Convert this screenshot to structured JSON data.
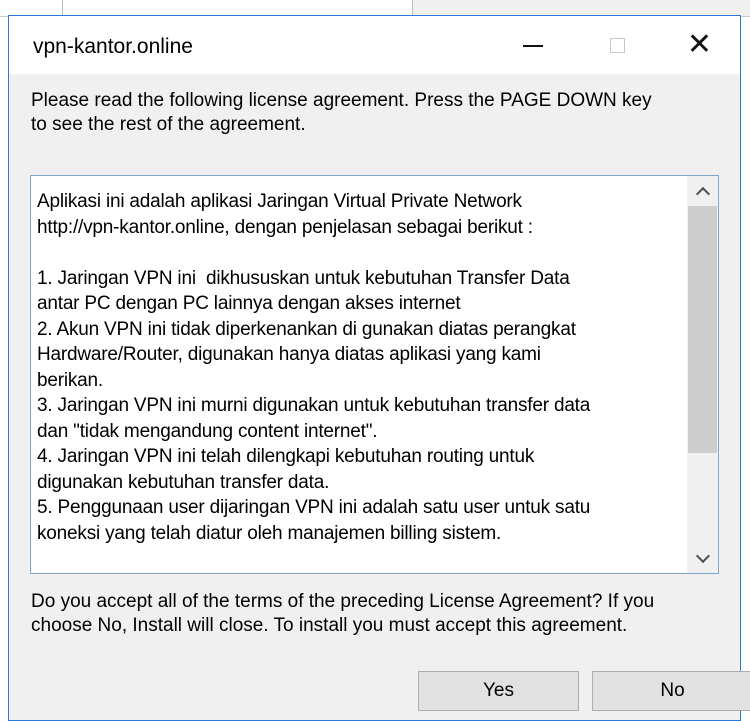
{
  "window": {
    "title": "vpn-kantor.online",
    "controls": {
      "minimize_icon": "minimize-icon",
      "maximize_icon": "maximize-icon",
      "close_icon": "close-icon",
      "close_glyph": "✕"
    }
  },
  "intro": {
    "line1": "Please read the following license agreement. Press the PAGE DOWN key",
    "line2": "to see the rest of the agreement."
  },
  "license": {
    "lines": [
      "Aplikasi ini adalah aplikasi Jaringan Virtual Private Network",
      "http://vpn-kantor.online, dengan penjelasan sebagai berikut :",
      "",
      "1. Jaringan VPN ini  dikhususkan untuk kebutuhan Transfer Data",
      "antar PC dengan PC lainnya dengan akses internet",
      "2. Akun VPN ini tidak diperkenankan di gunakan diatas perangkat",
      "Hardware/Router, digunakan hanya diatas aplikasi yang kami",
      "berikan.",
      "3. Jaringan VPN ini murni digunakan untuk kebutuhan transfer data",
      "dan \"tidak mengandung content internet\".",
      "4. Jaringan VPN ini telah dilengkapi kebutuhan routing untuk",
      "digunakan kebutuhan transfer data.",
      "5. Penggunaan user dijaringan VPN ini adalah satu user untuk satu",
      "koneksi yang telah diatur oleh manajemen billing sistem."
    ],
    "scrollbar": {
      "up_icon": "scroll-up-icon",
      "down_icon": "scroll-down-icon"
    }
  },
  "question": {
    "line1": "Do you accept all of the terms of the preceding License Agreement? If you",
    "line2": "choose No, Install will close. To install you must accept this agreement."
  },
  "buttons": {
    "yes_label": "Yes",
    "no_label": "No"
  },
  "colors": {
    "window_border": "#2b79d6",
    "dialog_background": "#f0f0f0",
    "license_border": "#82a7c8",
    "button_background": "#e1e1e1"
  }
}
